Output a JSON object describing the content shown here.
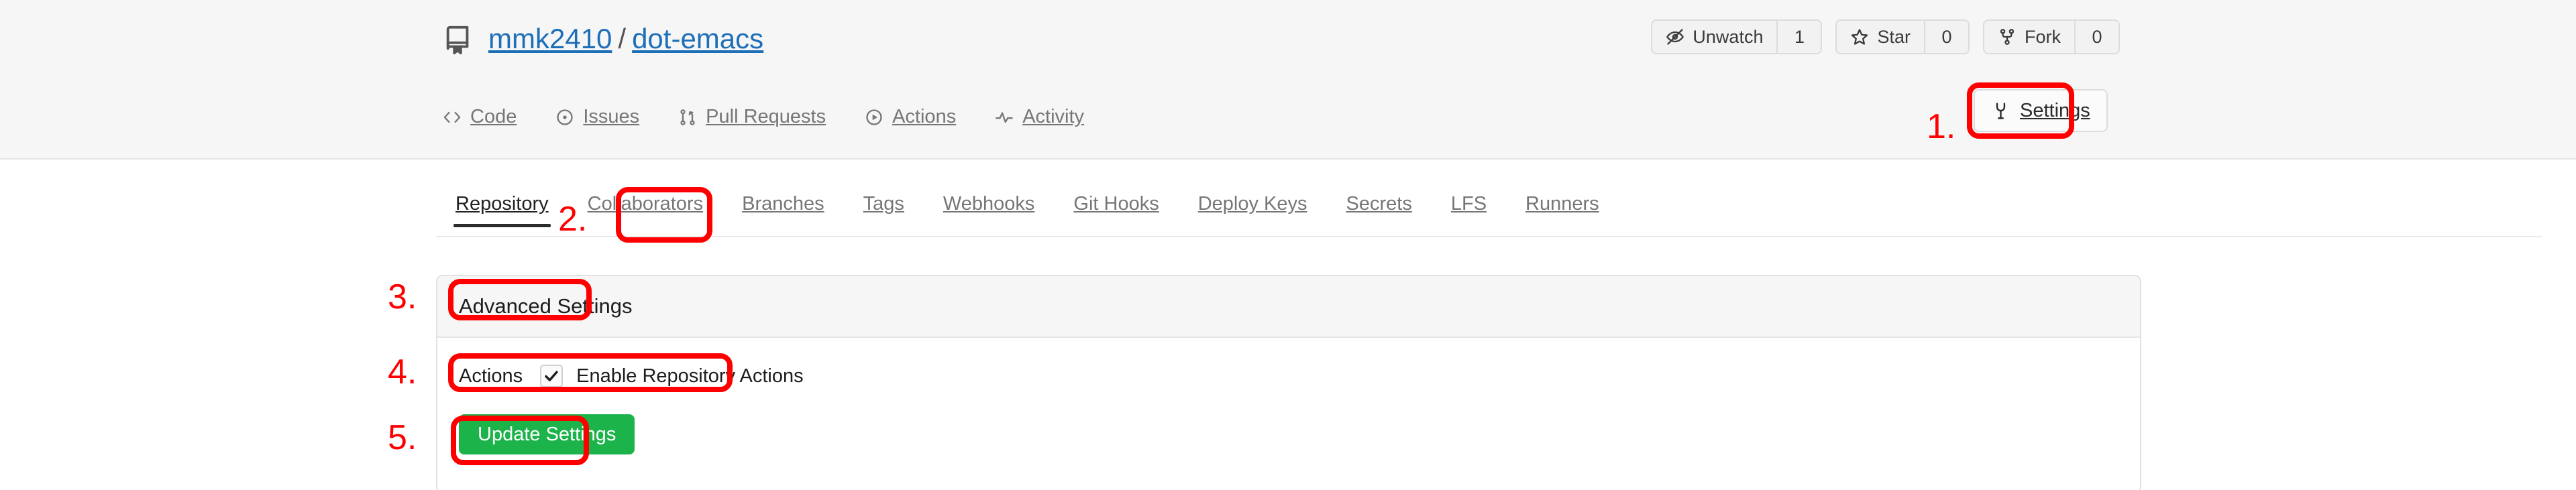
{
  "repo": {
    "icon": "repo-book-icon",
    "owner": "mmk2410",
    "separator": "/",
    "name": "dot-emacs"
  },
  "repo_actions": [
    {
      "icon": "eye-slash-icon",
      "label": "Unwatch",
      "count": "1"
    },
    {
      "icon": "star-icon",
      "label": "Star",
      "count": "0"
    },
    {
      "icon": "fork-icon",
      "label": "Fork",
      "count": "0"
    }
  ],
  "repo_nav": [
    {
      "icon": "code-icon",
      "label": "Code"
    },
    {
      "icon": "issue-opened-icon",
      "label": "Issues"
    },
    {
      "icon": "git-pull-request-icon",
      "label": "Pull Requests"
    },
    {
      "icon": "play-circle-icon",
      "label": "Actions"
    },
    {
      "icon": "pulse-icon",
      "label": "Activity"
    }
  ],
  "settings_button": {
    "icon": "tools-icon",
    "label": "Settings"
  },
  "sub_nav": [
    {
      "label": "Repository",
      "active": true
    },
    {
      "label": "Collaborators",
      "active": false
    },
    {
      "label": "Branches",
      "active": false
    },
    {
      "label": "Tags",
      "active": false
    },
    {
      "label": "Webhooks",
      "active": false
    },
    {
      "label": "Git Hooks",
      "active": false
    },
    {
      "label": "Deploy Keys",
      "active": false
    },
    {
      "label": "Secrets",
      "active": false
    },
    {
      "label": "LFS",
      "active": false
    },
    {
      "label": "Runners",
      "active": false
    }
  ],
  "panel": {
    "title": "Advanced Settings",
    "actions_label": "Actions",
    "enable_actions_label": "Enable Repository Actions",
    "enable_actions_checked": true,
    "checkmark_icon": "check-icon",
    "submit_label": "Update Settings"
  },
  "annotations": [
    {
      "number": "1."
    },
    {
      "number": "2."
    },
    {
      "number": "3."
    },
    {
      "number": "4."
    },
    {
      "number": "5."
    }
  ],
  "colors": {
    "annotation_red": "#ff0000",
    "link_blue": "#1d6fb8",
    "primary_green": "#1cb34a",
    "header_bg": "#f6f6f6"
  }
}
